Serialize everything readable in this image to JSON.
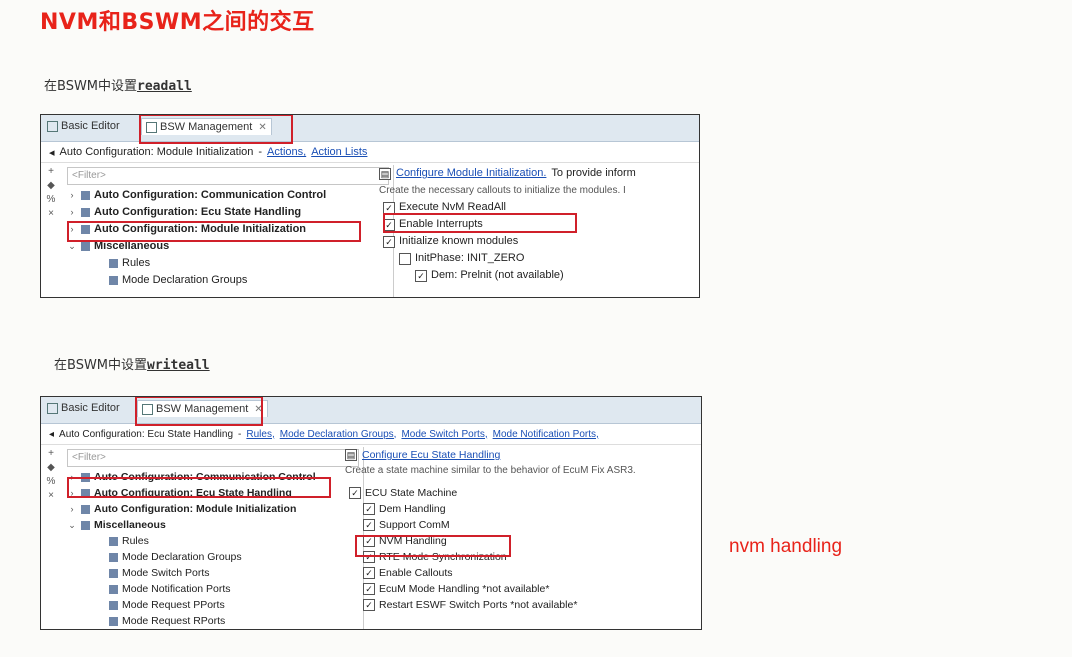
{
  "title": "NVM和BSWM之间的交互",
  "annotation": "nvm handling",
  "panels": [
    {
      "caption_prefix": "在BSWM中设置",
      "caption_code": "readall",
      "tabs": [
        "Basic Editor",
        "BSW Management"
      ],
      "breadcrumb": "Auto Configuration: Module Initialization",
      "breadcrumb_links": [
        "Actions,",
        "Action Lists"
      ],
      "filter": "<Filter>",
      "tree": [
        {
          "label": "Auto Configuration: Communication Control",
          "bold": true,
          "arrow": "›"
        },
        {
          "label": "Auto Configuration: Ecu State Handling",
          "bold": true,
          "arrow": "›"
        },
        {
          "label": "Auto Configuration: Module Initialization",
          "bold": true,
          "arrow": "›"
        },
        {
          "label": "Miscellaneous",
          "bold": true,
          "arrow": "⌄"
        },
        {
          "label": "Rules",
          "bold": false,
          "arrow": ""
        },
        {
          "label": "Mode Declaration Groups",
          "bold": false,
          "arrow": ""
        }
      ],
      "right_link": "Configure Module Initialization.",
      "right_link_tail": "To provide inform",
      "right_desc": "Create the necessary callouts to initialize the modules. I",
      "options": [
        {
          "label": "Execute NvM ReadAll",
          "checked": true
        },
        {
          "label": "Enable Interrupts",
          "checked": true
        },
        {
          "label": "Initialize known modules",
          "checked": true
        },
        {
          "label": "InitPhase: INIT_ZERO",
          "checked": false
        },
        {
          "label": "Dem: Prelnit (not available)",
          "checked": true
        }
      ]
    },
    {
      "caption_prefix": "在BSWM中设置",
      "caption_code": "writeall",
      "tabs": [
        "Basic Editor",
        "BSW Management"
      ],
      "breadcrumb": "Auto Configuration: Ecu State Handling",
      "breadcrumb_links": [
        "Rules,",
        "Mode Declaration Groups,",
        "Mode Switch Ports,",
        "Mode Notification Ports,"
      ],
      "filter": "<Filter>",
      "tree": [
        {
          "label": "Auto Configuration: Communication Control",
          "bold": true,
          "arrow": "›"
        },
        {
          "label": "Auto Configuration: Ecu State Handling",
          "bold": true,
          "arrow": "›"
        },
        {
          "label": "Auto Configuration: Module Initialization",
          "bold": true,
          "arrow": "›"
        },
        {
          "label": "Miscellaneous",
          "bold": true,
          "arrow": "⌄"
        },
        {
          "label": "Rules",
          "bold": false,
          "arrow": ""
        },
        {
          "label": "Mode Declaration Groups",
          "bold": false,
          "arrow": ""
        },
        {
          "label": "Mode Switch Ports",
          "bold": false,
          "arrow": ""
        },
        {
          "label": "Mode Notification Ports",
          "bold": false,
          "arrow": ""
        },
        {
          "label": "Mode Request PPorts",
          "bold": false,
          "arrow": ""
        },
        {
          "label": "Mode Request RPorts",
          "bold": false,
          "arrow": ""
        }
      ],
      "right_link": "Configure Ecu State Handling",
      "right_link_tail": "",
      "right_desc": "Create a state machine similar to the behavior of EcuM Fix ASR3.",
      "options": [
        {
          "label": "ECU State Machine",
          "checked": true
        },
        {
          "label": "Dem Handling",
          "checked": true
        },
        {
          "label": "Support ComM",
          "checked": true
        },
        {
          "label": "NVM Handling",
          "checked": true
        },
        {
          "label": "RTE Mode Synchronization",
          "checked": true
        },
        {
          "label": "Enable Callouts",
          "checked": true
        },
        {
          "label": "EcuM Mode Handling *not available*",
          "checked": true
        },
        {
          "label": "Restart ESWF Switch Ports *not available*",
          "checked": true
        }
      ]
    }
  ]
}
